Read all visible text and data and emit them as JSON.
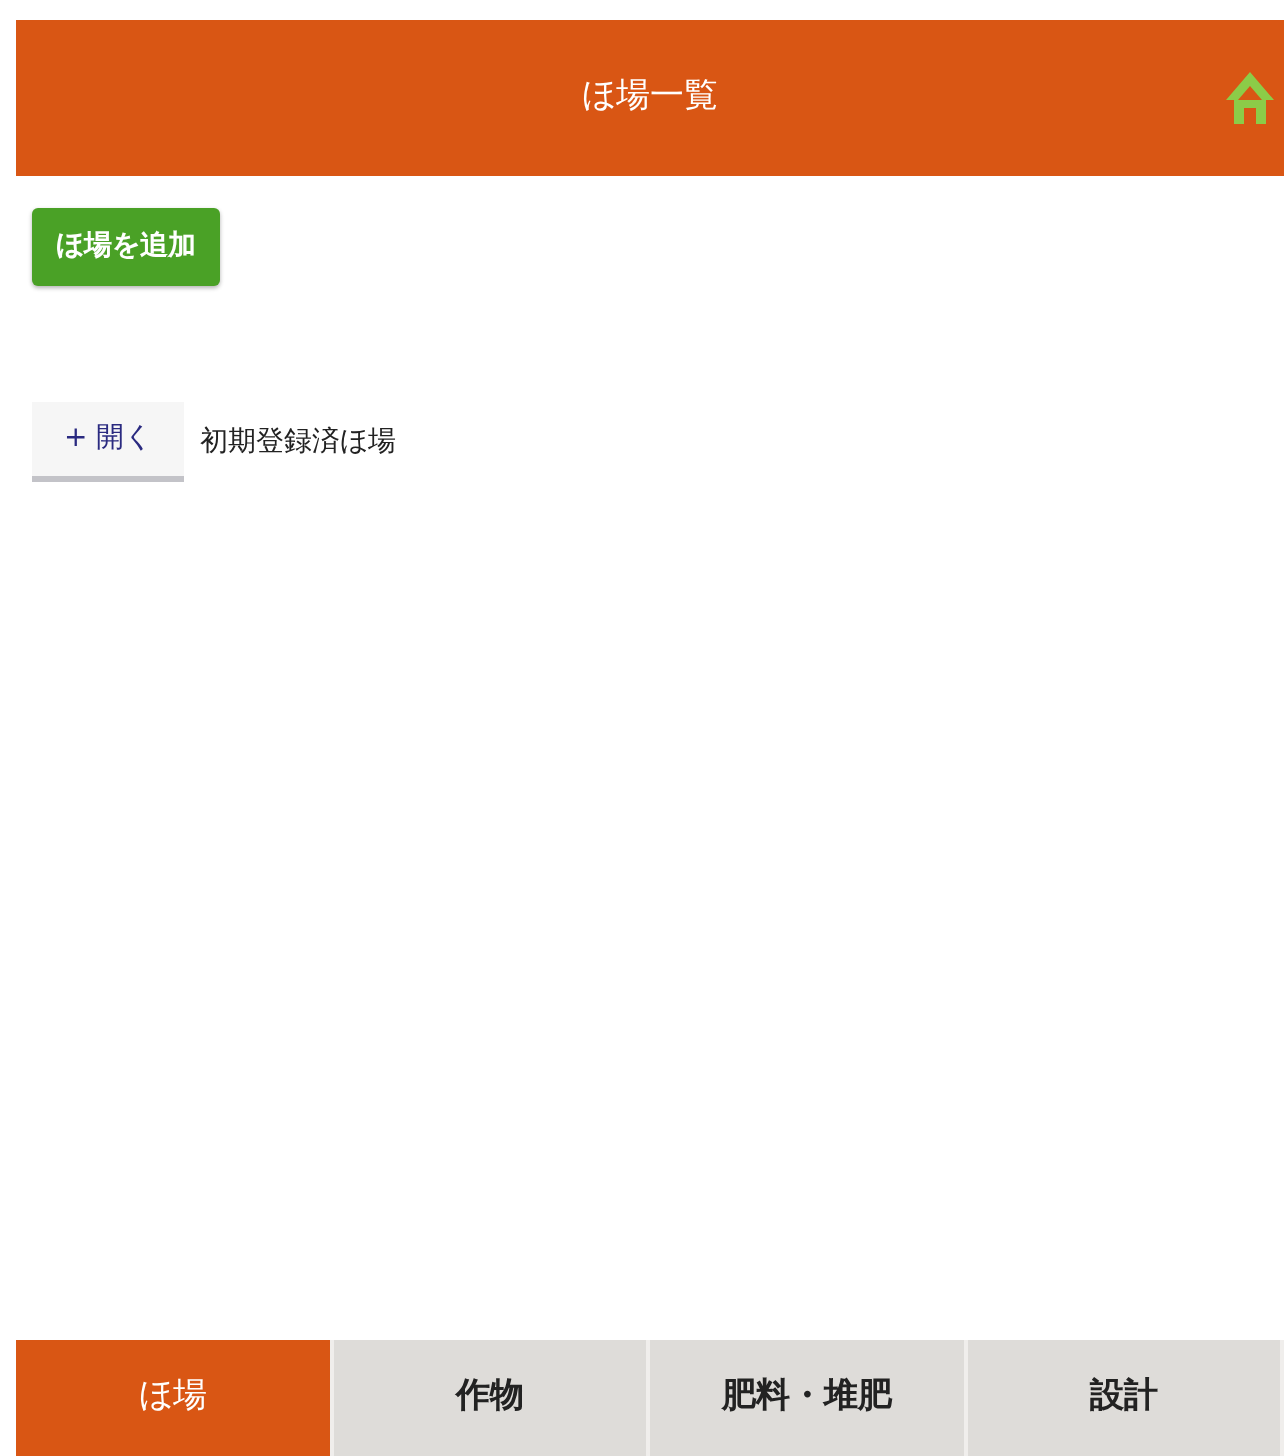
{
  "header": {
    "title": "ほ場一覧"
  },
  "add_button": "ほ場を追加",
  "groups": [
    {
      "toggle": "+ 開く",
      "name": "初期登録済ほ場"
    }
  ],
  "tabs": [
    {
      "label": "ほ場",
      "selected": true
    },
    {
      "label": "作物",
      "selected": false
    },
    {
      "label": "肥料・堆肥",
      "selected": false
    },
    {
      "label": "設計",
      "selected": false
    }
  ]
}
